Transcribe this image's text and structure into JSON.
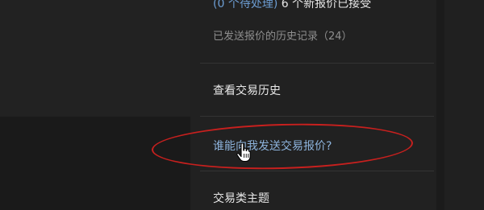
{
  "offers": {
    "pending_label": "(0 个待处理)",
    "new_offers_label": "6 个新报价已接受"
  },
  "history_offers_label": "已发送报价的历史记录（24）",
  "menu": {
    "trade_history": "查看交易历史",
    "who_can_send": "谁能向我发送交易报价?",
    "trade_topics": "交易类主题"
  },
  "colors": {
    "link_blue": "#6d9ed4",
    "highlight_red": "#c8201e"
  },
  "icons": {
    "cursor": "hand-pointer-icon"
  }
}
